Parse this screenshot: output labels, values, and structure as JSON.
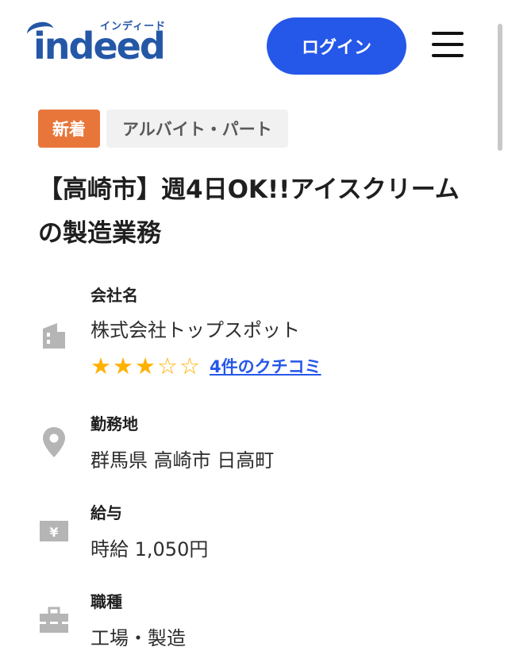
{
  "header": {
    "logo_word": "indeed",
    "logo_kana": "インディード",
    "login_label": "ログイン",
    "menu_icon": "hamburger-menu-icon"
  },
  "tags": {
    "new_label": "新着",
    "type_label": "アルバイト・パート"
  },
  "job": {
    "title": "【高崎市】週4日OK!!アイスクリームの製造業務"
  },
  "company": {
    "label": "会社名",
    "name": "株式会社トップスポット",
    "rating": 3,
    "rating_max": 5,
    "review_link": "4件のクチコミ",
    "icon": "building-icon"
  },
  "location": {
    "label": "勤務地",
    "value": "群馬県 高崎市 日高町",
    "icon": "map-pin-icon"
  },
  "salary": {
    "label": "給与",
    "value": "時給 1,050円",
    "icon": "yen-icon"
  },
  "occupation": {
    "label": "職種",
    "value": "工場・製造",
    "icon": "briefcase-icon"
  },
  "colors": {
    "brand": "#2557a7",
    "button": "#2557e9",
    "new_tag": "#e8763a",
    "star": "#ffb100"
  }
}
